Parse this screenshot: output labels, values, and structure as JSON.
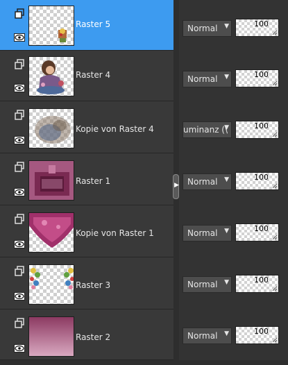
{
  "layers": [
    {
      "name": "Raster 5",
      "blend_mode": "Normal",
      "opacity": "100",
      "selected": true
    },
    {
      "name": "Raster 4",
      "blend_mode": "Normal",
      "opacity": "100",
      "selected": false
    },
    {
      "name": "Kopie von Raster 4",
      "blend_mode": "uminanz (\\",
      "opacity": "100",
      "selected": false
    },
    {
      "name": "Raster 1",
      "blend_mode": "Normal",
      "opacity": "100",
      "selected": false
    },
    {
      "name": "Kopie von Raster 1",
      "blend_mode": "Normal",
      "opacity": "100",
      "selected": false
    },
    {
      "name": "Raster 3",
      "blend_mode": "Normal",
      "opacity": "100",
      "selected": false
    },
    {
      "name": "Raster 2",
      "blend_mode": "Normal",
      "opacity": "100",
      "selected": false
    }
  ],
  "icons": {
    "link": "layer-link-icon",
    "visibility": "eye-icon",
    "dropdown": "chevron-down-icon",
    "splitter": "splitter-arrow-icon"
  },
  "colors": {
    "selected": "#3d9bf0",
    "panel": "#393939"
  }
}
